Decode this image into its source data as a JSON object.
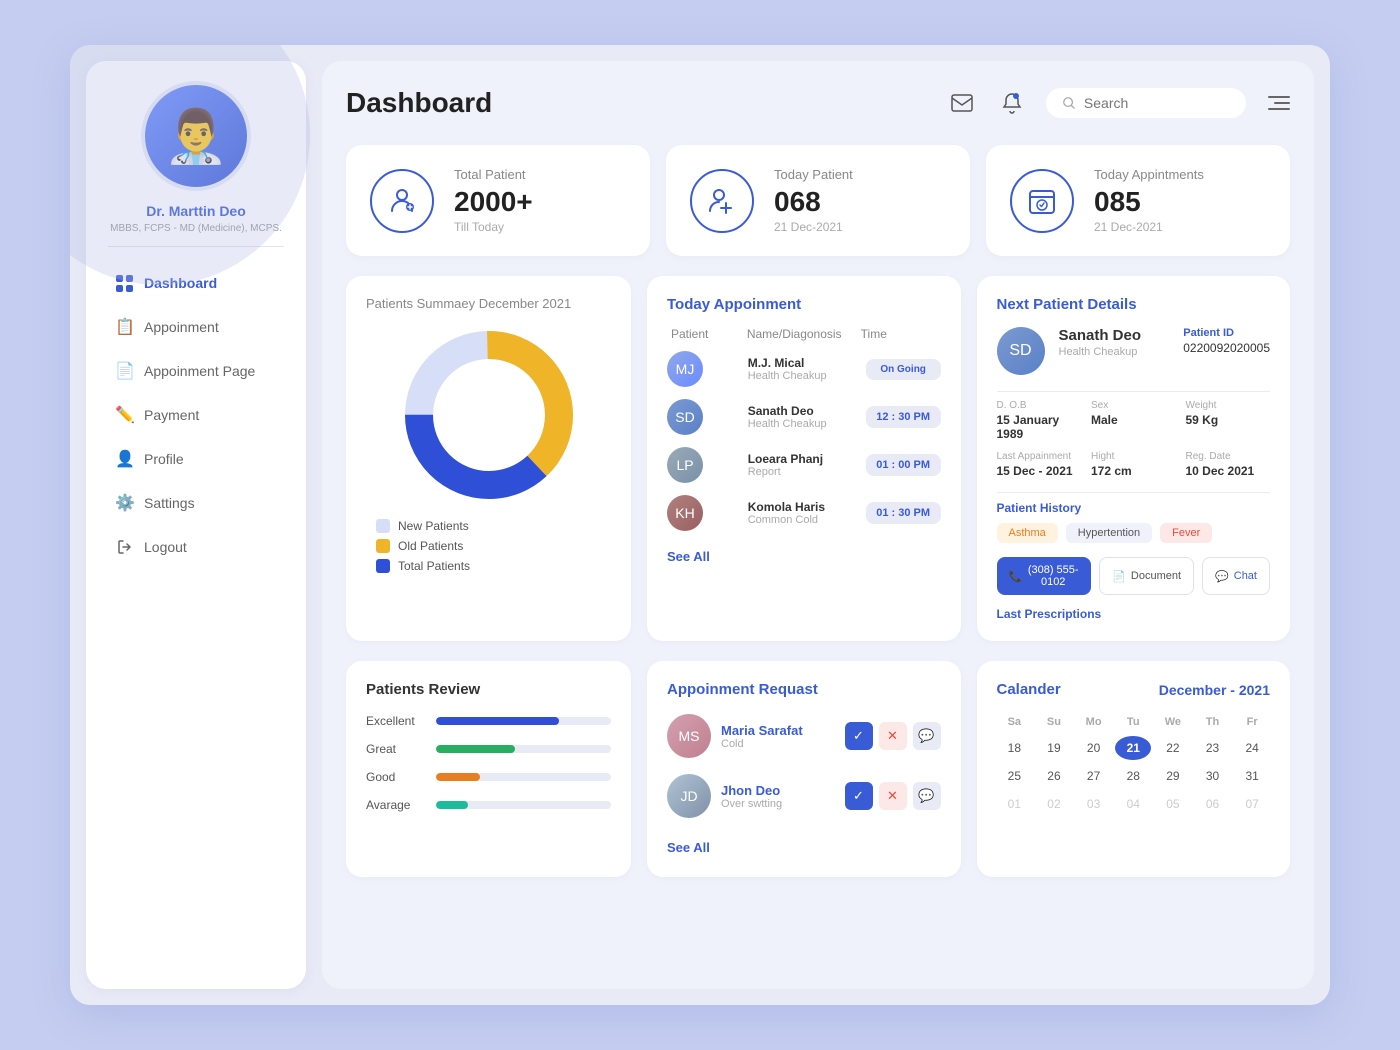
{
  "app": {
    "title": "Dashboard"
  },
  "header": {
    "search_placeholder": "Search",
    "search_value": ""
  },
  "doctor": {
    "name": "Dr. Marttin Deo",
    "title": "MBBS, FCPS - MD (Medicine), MCPS.",
    "avatar_emoji": "👨‍⚕️"
  },
  "sidebar": {
    "items": [
      {
        "id": "dashboard",
        "label": "Dashboard",
        "active": true,
        "icon": "⊞"
      },
      {
        "id": "appoinment",
        "label": "Appoinment",
        "active": false,
        "icon": "📋"
      },
      {
        "id": "appoinment-page",
        "label": "Appoinment Page",
        "active": false,
        "icon": "📄"
      },
      {
        "id": "payment",
        "label": "Payment",
        "active": false,
        "icon": "✏️"
      },
      {
        "id": "profile",
        "label": "Profile",
        "active": false,
        "icon": "👤"
      },
      {
        "id": "settings",
        "label": "Sattings",
        "active": false,
        "icon": "⚙️"
      },
      {
        "id": "logout",
        "label": "Logout",
        "active": false,
        "icon": "⬚"
      }
    ]
  },
  "stats": [
    {
      "id": "total-patient",
      "label": "Total Patient",
      "value": "2000+",
      "sub": "Till Today",
      "icon": "👤"
    },
    {
      "id": "today-patient",
      "label": "Today Patient",
      "value": "068",
      "sub": "21 Dec-2021",
      "icon": "🏥"
    },
    {
      "id": "today-appointments",
      "label": "Today Appintments",
      "value": "085",
      "sub": "21 Dec-2021",
      "icon": "🕐"
    }
  ],
  "patients_summary": {
    "title": "Patients Summaey December 2021",
    "donut": {
      "new_patients_pct": 25,
      "old_patients_pct": 38,
      "total_patients_pct": 37
    },
    "legend": [
      {
        "label": "New Patients",
        "color": "#d6dff7"
      },
      {
        "label": "Old Patients",
        "color": "#f0b429"
      },
      {
        "label": "Total Patients",
        "color": "#2e4fd6"
      }
    ]
  },
  "today_appointment": {
    "title": "Today Appoinment",
    "columns": [
      "Patient",
      "Name/Diagonosis",
      "Time"
    ],
    "rows": [
      {
        "name": "M.J. Mical",
        "diag": "Health Cheakup",
        "time": "On Going",
        "avatar": "MJ",
        "color": "#8fa8e8"
      },
      {
        "name": "Sanath Deo",
        "diag": "Health Cheakup",
        "time": "12 : 30 PM",
        "avatar": "SD",
        "color": "#7b9ad0"
      },
      {
        "name": "Loeara Phanj",
        "diag": "Report",
        "time": "01 : 00 PM",
        "avatar": "LP",
        "color": "#6b8cca"
      },
      {
        "name": "Komola Haris",
        "diag": "Common Cold",
        "time": "01 : 30 PM",
        "avatar": "KH",
        "color": "#5a7abf"
      }
    ],
    "see_all": "See All"
  },
  "next_patient": {
    "title": "Next Patient Details",
    "name": "Sanath Deo",
    "sub": "Health Cheakup",
    "patient_id_label": "Patient ID",
    "patient_id": "0220092020005",
    "avatar": "SD",
    "details": [
      {
        "label": "D. O.B",
        "value": "15 January 1989"
      },
      {
        "label": "Sex",
        "value": "Male"
      },
      {
        "label": "Weight",
        "value": "59 Kg"
      },
      {
        "label": "Last Appainment",
        "value": "15 Dec - 2021"
      },
      {
        "label": "Hight",
        "value": "172 cm"
      },
      {
        "label": "Reg. Date",
        "value": "10 Dec 2021"
      }
    ],
    "history_title": "Patient History",
    "tags": [
      "Asthma",
      "Hypertention",
      "Fever"
    ],
    "phone": "(308) 555- 0102",
    "btn_call": "(308) 555- 0102",
    "btn_doc": "Document",
    "btn_chat": "Chat",
    "last_prescriptions": "Last Prescriptions"
  },
  "patients_review": {
    "title": "Patients Review",
    "rows": [
      {
        "label": "Excellent",
        "pct": 70,
        "color": "#2e4fd6"
      },
      {
        "label": "Great",
        "pct": 45,
        "color": "#27ae60"
      },
      {
        "label": "Good",
        "pct": 25,
        "color": "#e67e22"
      },
      {
        "label": "Avarage",
        "pct": 18,
        "color": "#1abc9c"
      }
    ]
  },
  "appointment_request": {
    "title": "Appoinment Requast",
    "rows": [
      {
        "name": "Maria Sarafat",
        "diag": "Cold",
        "avatar": "MS",
        "color": "#d4a0b0"
      },
      {
        "name": "Jhon Deo",
        "diag": "Over swtting",
        "avatar": "JD",
        "color": "#b0c4d4"
      }
    ],
    "see_all": "See All"
  },
  "calendar": {
    "title": "Calander",
    "month": "December - 2021",
    "day_headers": [
      "Sa",
      "Su",
      "Mo",
      "Tu",
      "We",
      "Th",
      "Fr"
    ],
    "weeks": [
      [
        "18",
        "19",
        "20",
        "21",
        "22",
        "23",
        "24"
      ],
      [
        "25",
        "26",
        "27",
        "28",
        "29",
        "30",
        "31"
      ],
      [
        "01",
        "02",
        "03",
        "04",
        "05",
        "06",
        "07"
      ]
    ],
    "today": "21",
    "faded_days": [
      "01",
      "02",
      "03",
      "04",
      "05",
      "06",
      "07"
    ]
  }
}
